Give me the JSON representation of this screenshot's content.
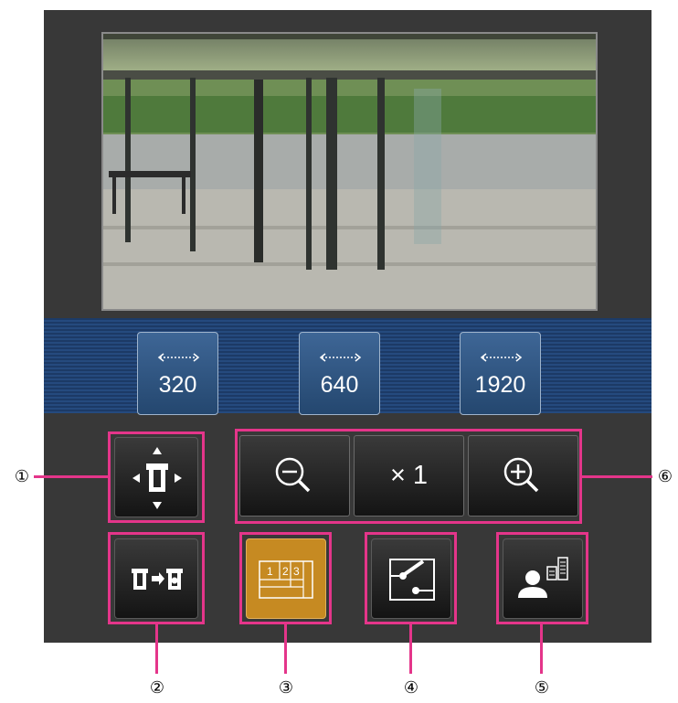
{
  "resolution_buttons": [
    {
      "label": "320"
    },
    {
      "label": "640"
    },
    {
      "label": "1920"
    }
  ],
  "zoom": {
    "label": "× 1"
  },
  "multiscreen_icon_digits": [
    "1",
    "2",
    "3"
  ],
  "callouts": [
    "①",
    "②",
    "③",
    "④",
    "⑤",
    "⑥"
  ],
  "colors": {
    "panel": "#383838",
    "resolution_bar": "#1c3a66",
    "highlight_border": "#e4358a",
    "multiscreen_active": "#c68a22"
  },
  "icons": [
    "pan-tilt-control-icon",
    "zoom-out-icon",
    "zoom-in-icon",
    "camera-switch-icon",
    "multiscreen-icon",
    "image-adjust-icon",
    "user-status-icon"
  ]
}
